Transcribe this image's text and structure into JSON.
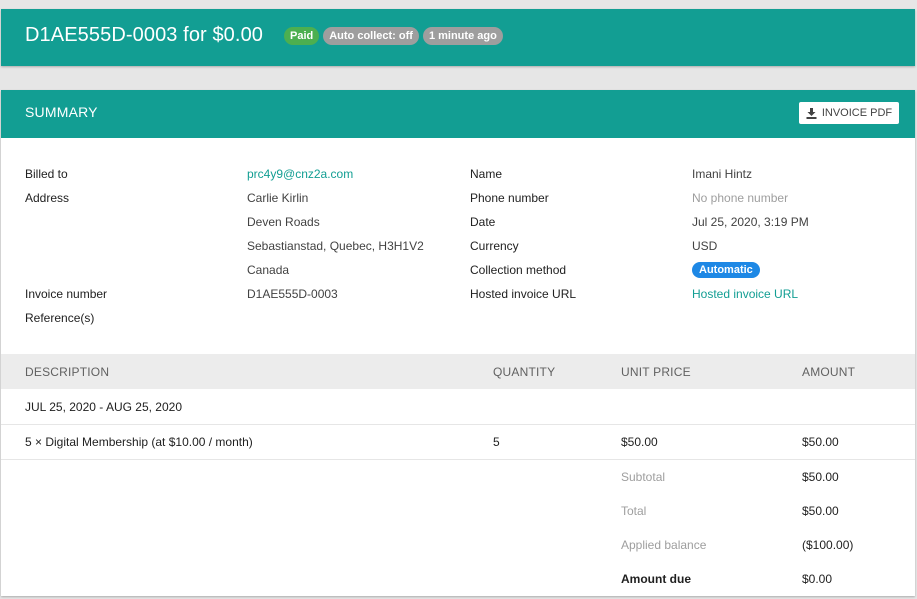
{
  "header": {
    "title": "D1AE555D-0003 for $0.00",
    "badges": {
      "paid": "Paid",
      "auto_collect": "Auto collect: off",
      "time_ago": "1 minute ago"
    }
  },
  "summary": {
    "title": "SUMMARY",
    "pdf_button": "INVOICE PDF",
    "left": {
      "billed_to_label": "Billed to",
      "billed_to_value": "prc4y9@cnz2a.com",
      "address_label": "Address",
      "address_lines": [
        "Carlie Kirlin",
        "Deven Roads",
        "Sebastianstad, Quebec, H3H1V2",
        "Canada"
      ],
      "invoice_number_label": "Invoice number",
      "invoice_number_value": "D1AE555D-0003",
      "references_label": "Reference(s)"
    },
    "right": {
      "name_label": "Name",
      "name_value": "Imani Hintz",
      "phone_label": "Phone number",
      "phone_value": "No phone number",
      "date_label": "Date",
      "date_value": "Jul 25, 2020, 3:19 PM",
      "currency_label": "Currency",
      "currency_value": "USD",
      "collection_label": "Collection method",
      "collection_value": "Automatic",
      "hosted_label": "Hosted invoice URL",
      "hosted_value": "Hosted invoice URL"
    }
  },
  "table": {
    "columns": [
      "DESCRIPTION",
      "QUANTITY",
      "UNIT PRICE",
      "AMOUNT"
    ],
    "period": "JUL 25, 2020 - AUG 25, 2020",
    "items": [
      {
        "description": "5 × Digital Membership (at $10.00 / month)",
        "quantity": "5",
        "unit_price": "$50.00",
        "amount": "$50.00"
      }
    ],
    "totals": [
      {
        "label": "Subtotal",
        "value": "$50.00"
      },
      {
        "label": "Total",
        "value": "$50.00"
      },
      {
        "label": "Applied balance",
        "value": "($100.00)"
      },
      {
        "label": "Amount due",
        "value": "$0.00"
      }
    ]
  },
  "colors": {
    "teal": "#129e93",
    "paid_badge": "#4caf50",
    "grey_badge": "#9e9e9e",
    "automatic_chip": "#1e88e5"
  },
  "icons": {
    "pdf_button_icon": "download-icon"
  }
}
